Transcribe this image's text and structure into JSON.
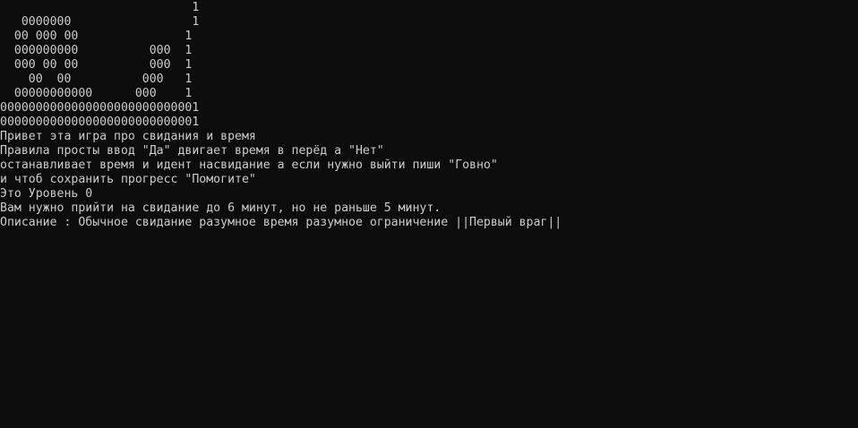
{
  "console": {
    "lines": [
      "                           1",
      "   0000000                 1",
      "  00 000 00               1",
      "  000000000          000  1",
      "  000 00 00          000  1",
      "    00  00          000   1",
      "  00000000000      000    1",
      "0000000000000000000000000001",
      "0000000000000000000000000001",
      "Привет эта игра про свидания и время",
      "Правила просты ввод \"Да\" двигает время в перёд а \"Нет\"",
      "останавливает время и идент насвидание а если нужно выйти пиши \"Говно\"",
      "и чтоб сохранить прогресс \"Помогите\"",
      "Это Уровень 0",
      "Вам нужно прийти на свидание до 6 минут, но не раньше 5 минут.",
      "Описание : Обычное свидание разумное время разумное ограничение ||Первый враг||"
    ]
  }
}
